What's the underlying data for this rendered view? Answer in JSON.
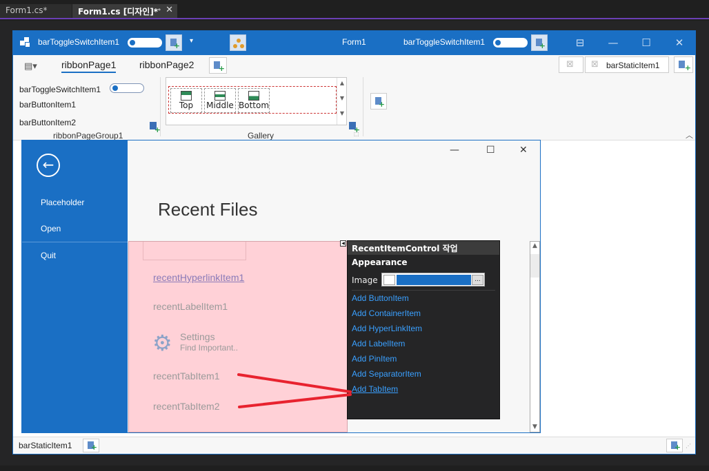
{
  "ide_tabs": [
    {
      "label": "Form1.cs*",
      "active": false
    },
    {
      "label": "Form1.cs [디자인]*",
      "active": true
    }
  ],
  "title_bar": {
    "left_toggle_label": "barToggleSwitchItem1",
    "form_title": "Form1",
    "right_toggle_label": "barToggleSwitchItem1",
    "accent_color": "#1a6fc4"
  },
  "ribbon": {
    "tabs": [
      {
        "label": "ribbonPage1",
        "active": true
      },
      {
        "label": "ribbonPage2",
        "active": false
      }
    ],
    "right_items": {
      "static_item": "barStaticItem1"
    },
    "group1": {
      "toggle_label": "barToggleSwitchItem1",
      "button1": "barButtonItem1",
      "button2": "barButtonItem2",
      "caption": "ribbonPageGroup1"
    },
    "gallery": {
      "items": [
        "Top",
        "Middle",
        "Bottom"
      ],
      "caption": "Gallery"
    }
  },
  "backstage": {
    "menu": [
      "Placeholder",
      "Open",
      "Quit"
    ],
    "title": "Recent Files",
    "recent_items": {
      "hyperlink": "recentHyperlinkItem1",
      "label": "recentLabelItem1",
      "settings_title": "Settings",
      "settings_sub": "Find Important..",
      "tab1": "recentTabItem1",
      "tab2": "recentTabItem2"
    }
  },
  "smart_tag": {
    "header": "RecentItemControl 작업",
    "section": "Appearance",
    "image_label": "Image",
    "image_button": "...",
    "links": [
      "Add ButtonItem",
      "Add ContainerItem",
      "Add HyperLinkItem",
      "Add LabelItem",
      "Add PinItem",
      "Add SeparatorItem",
      "Add TabItem"
    ]
  },
  "status_bar": {
    "text": "barStaticItem1"
  },
  "annotation_color": "#e8232f"
}
